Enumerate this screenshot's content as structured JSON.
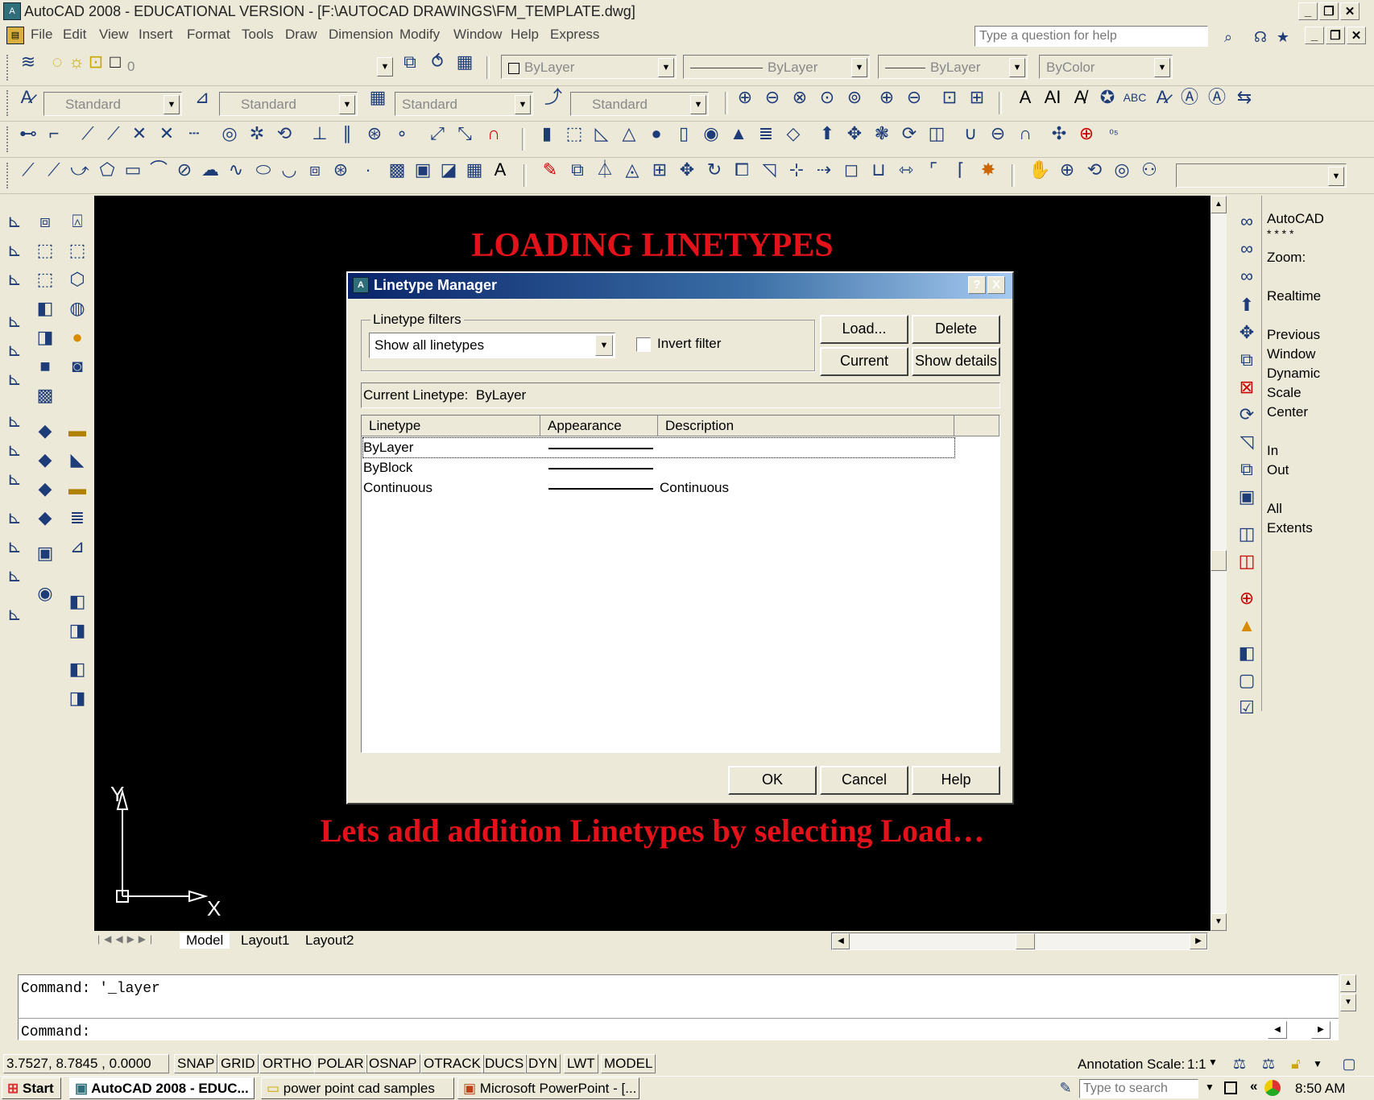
{
  "app": {
    "window_title": "AutoCAD 2008 - EDUCATIONAL VERSION - [F:\\AUTOCAD DRAWINGS\\FM_TEMPLATE.dwg]"
  },
  "menu": [
    "File",
    "Edit",
    "View",
    "Insert",
    "Format",
    "Tools",
    "Draw",
    "Dimension",
    "Modify",
    "Window",
    "Help",
    "Express"
  ],
  "help_search": {
    "placeholder": "Type a question for help"
  },
  "layers_toolbar": {
    "layer_value": "0"
  },
  "properties_toolbar": {
    "color": "ByLayer",
    "linetype": "ByLayer",
    "lineweight": "ByLayer",
    "plotstyle": "ByColor"
  },
  "styles_toolbar": {
    "text_style": "Standard",
    "dim_style": "Standard",
    "table_style": "Standard",
    "multileader_style": "Standard"
  },
  "canvas": {
    "heading": "LOADING LINETYPES",
    "note": "Lets add addition Linetypes by selecting Load…",
    "ucs_y": "Y",
    "ucs_x": "X",
    "background": "#000000",
    "annotation_color": "#e3121a"
  },
  "dialog": {
    "title": "Linetype Manager",
    "help_btn": "?",
    "close_btn": "X",
    "filters_group": "Linetype filters",
    "filter_value": "Show all linetypes",
    "invert_filter": "Invert filter",
    "invert_checked": false,
    "buttons": {
      "load": "Load...",
      "delete": "Delete",
      "current": "Current",
      "show_details": "Show details",
      "ok": "OK",
      "cancel": "Cancel",
      "help": "Help"
    },
    "current_linetype_label": "Current Linetype:",
    "current_linetype_value": "ByLayer",
    "columns": [
      "Linetype",
      "Appearance",
      "Description"
    ],
    "rows": [
      {
        "name": "ByLayer",
        "description": ""
      },
      {
        "name": "ByBlock",
        "description": ""
      },
      {
        "name": "Continuous",
        "description": "Continuous"
      }
    ]
  },
  "zoom_panel": {
    "title": "AutoCAD",
    "stars": "* * * *",
    "items": [
      "Zoom:",
      "Realtime",
      "Previous",
      "Window",
      "Dynamic",
      "Scale",
      "Center",
      "In",
      "Out",
      "All",
      "Extents"
    ]
  },
  "layout_tabs": [
    "Model",
    "Layout1",
    "Layout2"
  ],
  "command": {
    "line1": "Command: '_layer",
    "line2": "Command:"
  },
  "status": {
    "coords": "3.7527, 8.7845 , 0.0000",
    "toggles": [
      "SNAP",
      "GRID",
      "ORTHO",
      "POLAR",
      "OSNAP",
      "OTRACK",
      "DUCS",
      "DYN",
      "LWT",
      "MODEL"
    ],
    "annotation_scale_label": "Annotation Scale:",
    "annotation_scale_value": "1:1"
  },
  "taskbar": {
    "start": "Start",
    "tasks": [
      "AutoCAD 2008 - EDUC...",
      "power point cad samples",
      "Microsoft PowerPoint - [..."
    ],
    "search_placeholder": "Type to search",
    "clock": "8:50 AM"
  }
}
